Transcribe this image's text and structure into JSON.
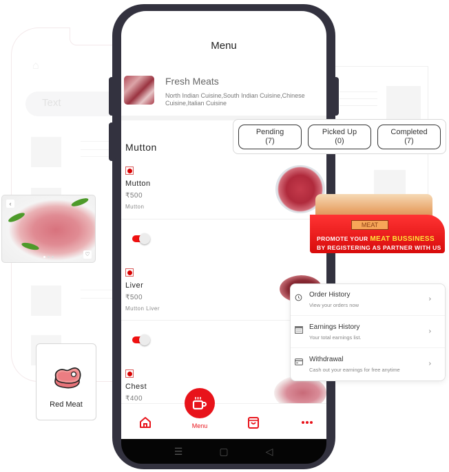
{
  "background": {
    "ghost_search_placeholder": "Text"
  },
  "screen": {
    "title": "Menu",
    "store": {
      "name": "Fresh Meats",
      "cuisines": "North Indian Cuisine,South Indian Cuisine,Chinese Cuisine,Italian Cuisine"
    },
    "category": "Mutton",
    "items": [
      {
        "name": "Mutton",
        "price": "₹500",
        "description": "Mutton",
        "available": true
      },
      {
        "name": "Liver",
        "price": "₹500",
        "description": "Mutton Liver",
        "available": true
      },
      {
        "name": "Chest",
        "price": "₹400",
        "description": ""
      }
    ],
    "bottom_nav": {
      "active_label": "Menu",
      "items": [
        "home",
        "menu",
        "orders",
        "more"
      ]
    },
    "system_nav": [
      "menu",
      "home",
      "back"
    ]
  },
  "status_card": {
    "buttons": [
      {
        "label": "Pending",
        "count": "(7)"
      },
      {
        "label": "Picked Up",
        "count": "(0)"
      },
      {
        "label": "Completed",
        "count": "(7)"
      }
    ]
  },
  "promo": {
    "sign": "MEAT",
    "line1_prefix": "PROMOTE YOUR ",
    "line1_highlight": "MEAT BUSSINESS",
    "line2": "BY REGISTERING AS PARTNER WITH US"
  },
  "options_card": {
    "items": [
      {
        "title": "Order History",
        "subtitle": "View your orders now",
        "icon": "clock-icon"
      },
      {
        "title": "Earnings History",
        "subtitle": "Your total earnings list.",
        "icon": "calendar-icon"
      },
      {
        "title": "Withdrawal",
        "subtitle": "Cash out your earnings for free anytime",
        "icon": "card-icon"
      }
    ]
  },
  "category_card": {
    "label": "Red Meat"
  },
  "colors": {
    "accent": "#e8131a",
    "frame": "#33323f"
  }
}
